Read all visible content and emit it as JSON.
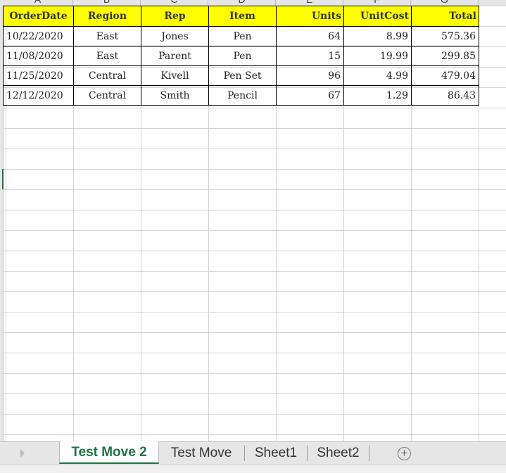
{
  "columns": [
    "A",
    "B",
    "C",
    "D",
    "E",
    "F",
    "G"
  ],
  "table": {
    "headers": [
      "OrderDate",
      "Region",
      "Rep",
      "Item",
      "Units",
      "UnitCost",
      "Total"
    ],
    "rows": [
      [
        "10/22/2020",
        "East",
        "Jones",
        "Pen",
        "64",
        "8.99",
        "575.36"
      ],
      [
        "11/08/2020",
        "East",
        "Parent",
        "Pen",
        "15",
        "19.99",
        "299.85"
      ],
      [
        "11/25/2020",
        "Central",
        "Kivell",
        "Pen Set",
        "96",
        "4.99",
        "479.04"
      ],
      [
        "12/12/2020",
        "Central",
        "Smith",
        "Pencil",
        "67",
        "1.29",
        "86.43"
      ]
    ]
  },
  "tabs": [
    "Test Move 2",
    "Test Move",
    "Sheet1",
    "Sheet2"
  ],
  "add_sheet": "+",
  "colors": {
    "header_fill": "#ffff00",
    "accent": "#217346"
  }
}
